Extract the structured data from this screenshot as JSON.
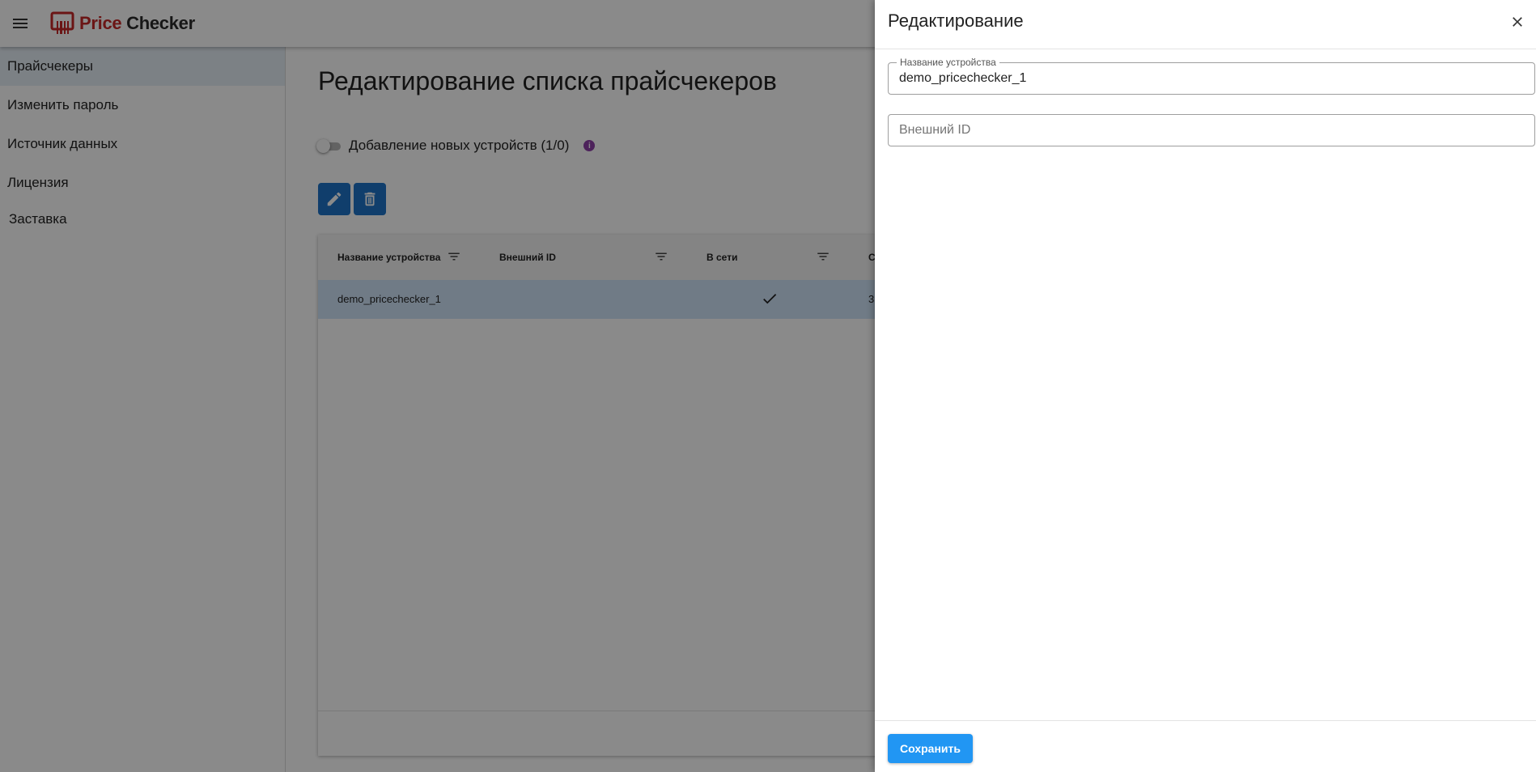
{
  "app": {
    "logo_price": "Price",
    "logo_checker": "Checker"
  },
  "sidebar": {
    "items": [
      {
        "label": "Прайсчекеры",
        "active": true
      },
      {
        "label": "Изменить пароль"
      },
      {
        "label": "Источник данных"
      },
      {
        "label": "Лицензия"
      },
      {
        "label": "Заставка"
      }
    ]
  },
  "main": {
    "title": "Редактирование списка прайсчекеров",
    "toggle_label": "Добавление новых устройств (1/0)",
    "info_symbol": "i",
    "table": {
      "headers": [
        "Название устройства",
        "Внешний ID",
        "В сети",
        "С"
      ],
      "rows": [
        {
          "name": "demo_pricechecker_1",
          "external_id": "",
          "online": true,
          "partial": "3"
        }
      ]
    }
  },
  "drawer": {
    "title": "Редактирование",
    "name_field_label": "Название устройства",
    "name_field_value": "demo_pricechecker_1",
    "external_id_placeholder": "Внешний ID",
    "save_label": "Сохранить"
  },
  "colors": {
    "brand_red": "#c62828",
    "action_blue": "#1e74c8",
    "save_blue": "#2196f3",
    "selected_row": "#cfe3f8",
    "info_purple": "#8e3fa8"
  }
}
